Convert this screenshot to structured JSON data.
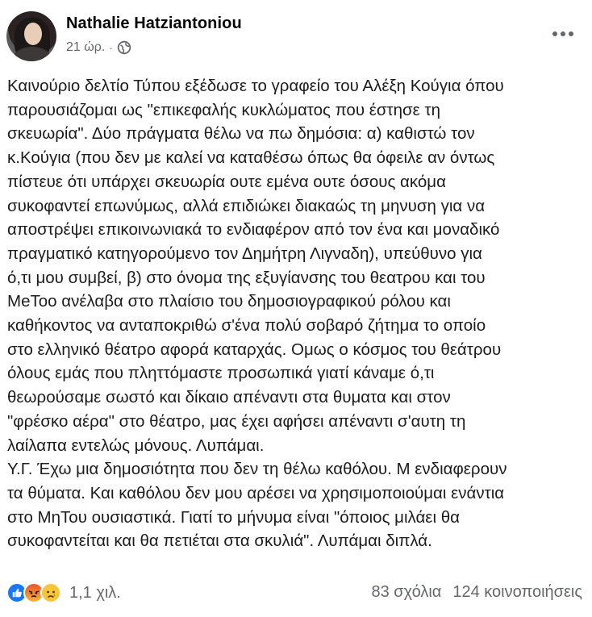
{
  "post": {
    "author": "Nathalie Hatziantoniou",
    "time": "21 ώρ.",
    "separator": "·",
    "audience_icon": "globe-icon",
    "more_icon": "more-horizontal-icon",
    "lines": [
      "Καινούριο δελτίο Τύπου εξέδωσε το γραφείο του Αλέξη Κούγια όπου",
      "παρουσιάζομαι ως \"επικεφαλής κυκλώματος που έστησε τη",
      "σκευωρία\". Δύο πράγματα θέλω να πω δημόσια: α) καθιστώ τον",
      "κ.Κούγια (που δεν με καλεί να καταθέσω όπως θα όφειλε αν όντως",
      "πίστευε ότι υπάρχει σκευωρία ουτε εμένα ουτε όσους ακόμα",
      "συκοφαντεί επωνύμως, αλλά επιδιώκει διακαώς τη μηνυση για να",
      "αποστρέψει επικοινωνιακά το ενδιαφέρον από τον ένα και μοναδικό",
      "πραγματικό κατηγορούμενο τον Δημήτρη Λιγναδη), υπεύθυνο για",
      "ό,τι μου συμβεί, β) στο όνομα της εξυγίανσης του θεατρου και του",
      "ΜeToo ανέλαβα στο πλαίσιο του δημοσιογραφικού ρόλου και",
      "καθήκοντος να ανταποκριθώ σ'ένα πολύ σοβαρό ζήτημα το οποίο",
      "στο ελληνικό θέατρο αφορά καταρχάς. Ομως ο κόσμος του θεάτρου",
      "όλους εμάς που πληττόμαστε προσωπικά γιατί κάναμε ό,τι",
      "θεωρούσαμε σωστό και δίκαιο απέναντι στα θυματα και στον",
      "\"φρέσκο αέρα\" στο θέατρο, μας έχει αφήσει απέναντι σ'αυτη τη",
      "λαίλαπα εντελώς μόνους. Λυπάμαι.",
      "Υ.Γ. Έχω μια δημοσιότητα που δεν τη θέλω καθόλου. Μ ενδιαφερουν",
      "τα θύματα. Και καθόλου δεν μου αρέσει να χρησιμοποιούμαι ενάντια",
      "στο ΜηΤου ουσιαστικά. Γιατί το μήνυμα είναι \"όποιος μιλάει θα",
      "συκοφαντείται και θα πετιέται στα σκυλιά\". Λυπάμαι διπλά."
    ]
  },
  "footer": {
    "reaction_icons": [
      "like-icon",
      "angry-icon",
      "sad-icon"
    ],
    "reaction_count": "1,1 χιλ.",
    "comments": "83 σχόλια",
    "shares": "124 κοινοποιήσεις"
  },
  "colors": {
    "text": "#050505",
    "secondary": "#65676b",
    "like": "#1877f2"
  }
}
